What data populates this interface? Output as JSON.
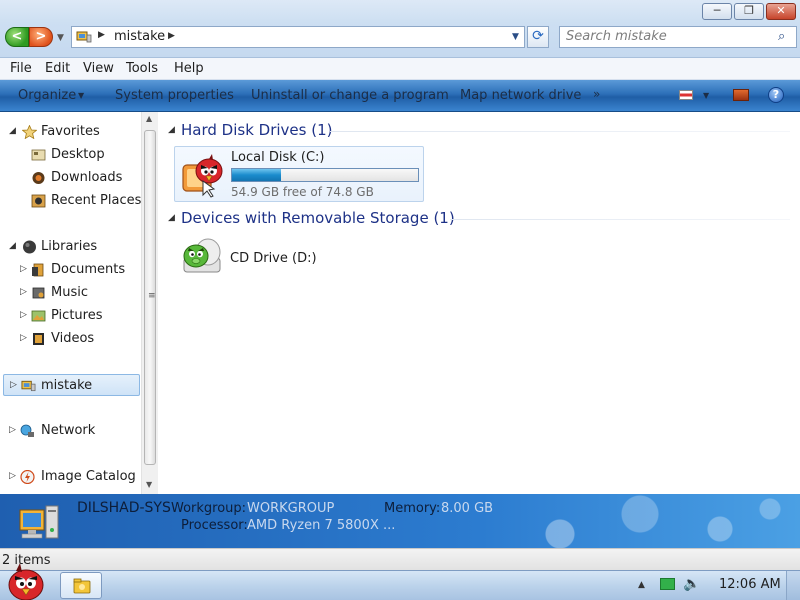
{
  "window": {
    "minimize_label": "─",
    "maximize_label": "❐",
    "close_label": "✕"
  },
  "navigation": {
    "back_label": "<",
    "forward_label": ">"
  },
  "address_bar": {
    "separator": "▶",
    "path": "mistake",
    "dropdown": "▼"
  },
  "search": {
    "placeholder": "Search mistake",
    "icon": "⌕"
  },
  "menu": {
    "items": [
      "File",
      "Edit",
      "View",
      "Tools",
      "Help"
    ]
  },
  "commands": {
    "organize": "Organize",
    "system_properties": "System properties",
    "uninstall": "Uninstall or change a program",
    "map_drive": "Map network drive",
    "more": "»",
    "help": "?"
  },
  "sidebar": {
    "favorites": {
      "label": "Favorites",
      "items": [
        "Desktop",
        "Downloads",
        "Recent Places"
      ]
    },
    "libraries": {
      "label": "Libraries",
      "items": [
        "Documents",
        "Music",
        "Pictures",
        "Videos"
      ]
    },
    "computer": "mistake",
    "network": "Network",
    "image_catalog": "Image Catalog",
    "scroll_grip": "≡"
  },
  "groups": {
    "hard_disks": "Hard Disk Drives (1)",
    "removable": "Devices with Removable Storage (1)"
  },
  "drives": {
    "c": {
      "name": "Local Disk (C:)",
      "free_text": "54.9 GB free of 74.8 GB",
      "used_fraction": 0.266
    },
    "d": {
      "name": "CD Drive (D:)"
    }
  },
  "details": {
    "computer_name": "DILSHAD-SYS",
    "workgroup_label": "Workgroup:",
    "workgroup_value": "WORKGROUP",
    "memory_label": "Memory:",
    "memory_value": "8.00 GB",
    "processor_label": "Processor:",
    "processor_value": "AMD Ryzen 7 5800X ..."
  },
  "status": {
    "items_count": "2 items"
  },
  "taskbar": {
    "clock": "12:06 AM",
    "tray_arrow": "▲",
    "volume": "🔈"
  },
  "colors": {
    "accent": "#2c6fb8",
    "group_heading": "#1e3287",
    "disk_fill": "#1b8ccd"
  }
}
